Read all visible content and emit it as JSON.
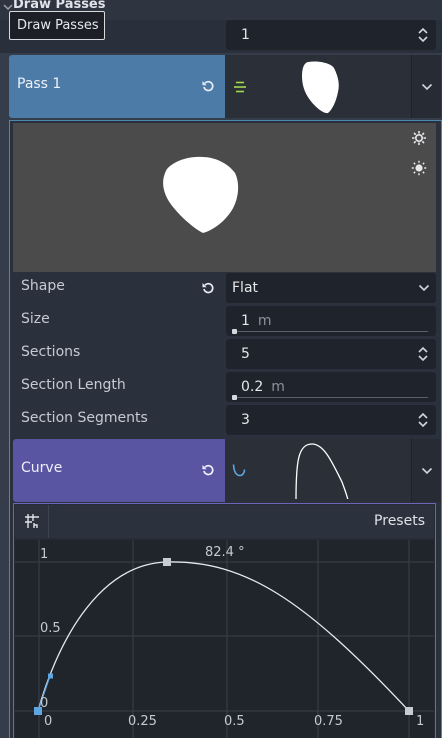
{
  "section": {
    "title": "Draw Passes"
  },
  "tooltip": {
    "text": "Draw Passes"
  },
  "passes_count": {
    "value": "1"
  },
  "pass1": {
    "label": "Pass 1"
  },
  "shape": {
    "label": "Shape",
    "value": "Flat"
  },
  "size": {
    "label": "Size",
    "value": "1",
    "unit": "m",
    "fraction": 0.0
  },
  "sections": {
    "label": "Sections",
    "value": "5"
  },
  "section_length": {
    "label": "Section Length",
    "value": "0.2",
    "unit": "m",
    "fraction": 0.0
  },
  "section_segments": {
    "label": "Section Segments",
    "value": "3"
  },
  "curve": {
    "label": "Curve",
    "presets_label": "Presets"
  },
  "curve_graph": {
    "angle_label": "82.4 °",
    "x_ticks": [
      "0",
      "0.25",
      "0.5",
      "0.75",
      "1"
    ],
    "y_ticks": [
      "1",
      "0.5",
      "0"
    ]
  },
  "colors": {
    "pass_button": "#4d7ba8",
    "curve_button": "#5a55a3",
    "panel_border": "#4c87b4",
    "accent_blue": "#5fa5e0"
  },
  "icons": [
    "chevron-down-icon",
    "revert-icon",
    "spin-arrows-icon",
    "gear-icon",
    "sun-icon",
    "grid-snap-icon",
    "curve-resource-icon",
    "mesh-resource-icon"
  ]
}
